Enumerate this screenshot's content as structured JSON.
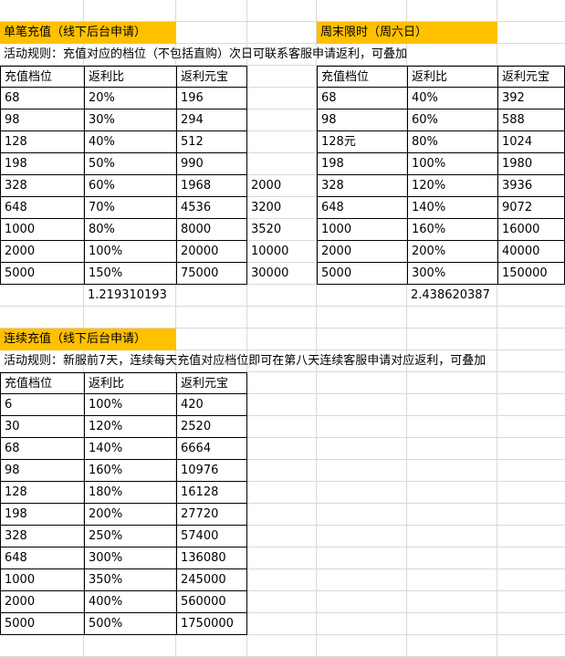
{
  "section1": {
    "title": "单笔充值（线下后台申请）",
    "rule": "活动规则：充值对应的档位（不包括直购）次日可联系客服申请返利，可叠加",
    "headers": [
      "充值档位",
      "返利比",
      "返利元宝"
    ],
    "rows": [
      [
        "68",
        "20%",
        "196",
        ""
      ],
      [
        "98",
        "30%",
        "294",
        ""
      ],
      [
        "128",
        "40%",
        "512",
        ""
      ],
      [
        "198",
        "50%",
        "990",
        ""
      ],
      [
        "328",
        "60%",
        "1968",
        "2000"
      ],
      [
        "648",
        "70%",
        "4536",
        "3200"
      ],
      [
        "1000",
        "80%",
        "8000",
        "3520"
      ],
      [
        "2000",
        "100%",
        "20000",
        "10000"
      ],
      [
        "5000",
        "150%",
        "75000",
        "30000"
      ]
    ],
    "ratio": "1.219310193"
  },
  "section2": {
    "title": "周末限时（周六日）",
    "headers": [
      "充值档位",
      "返利比",
      "返利元宝"
    ],
    "rows": [
      [
        "68",
        "40%",
        "392"
      ],
      [
        "98",
        "60%",
        "588"
      ],
      [
        "128元",
        "80%",
        "1024"
      ],
      [
        "198",
        "100%",
        "1980"
      ],
      [
        "328",
        "120%",
        "3936"
      ],
      [
        "648",
        "140%",
        "9072"
      ],
      [
        "1000",
        "160%",
        "16000"
      ],
      [
        "2000",
        "200%",
        "40000"
      ],
      [
        "5000",
        "300%",
        "150000"
      ]
    ],
    "ratio": "2.438620387"
  },
  "section3": {
    "title": "连续充值（线下后台申请）",
    "rule": "活动规则：新服前7天，连续每天充值对应档位即可在第八天连续客服申请对应返利，可叠加",
    "headers": [
      "充值档位",
      "返利比",
      "返利元宝"
    ],
    "rows": [
      [
        "6",
        "100%",
        "420"
      ],
      [
        "30",
        "120%",
        "2520"
      ],
      [
        "68",
        "140%",
        "6664"
      ],
      [
        "98",
        "160%",
        "10976"
      ],
      [
        "128",
        "180%",
        "16128"
      ],
      [
        "198",
        "200%",
        "27720"
      ],
      [
        "328",
        "250%",
        "57400"
      ],
      [
        "648",
        "300%",
        "136080"
      ],
      [
        "1000",
        "350%",
        "245000"
      ],
      [
        "2000",
        "400%",
        "560000"
      ],
      [
        "5000",
        "500%",
        "1750000"
      ]
    ]
  },
  "colors": {
    "header_fill": "#ffc000",
    "gridline": "#d9d9d9",
    "border": "#000000"
  }
}
